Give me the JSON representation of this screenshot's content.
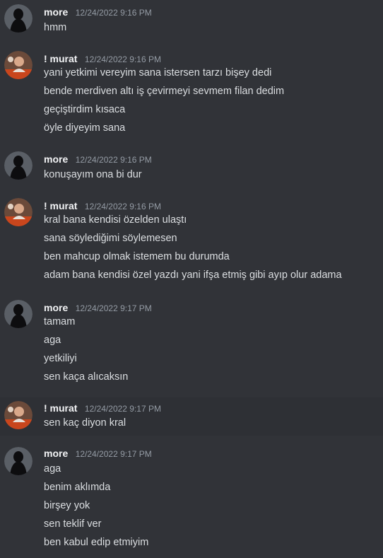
{
  "channel": {
    "messages": [
      {
        "author": "more",
        "timestamp": "12/24/2022 9:16 PM",
        "avatar": "dark-hooded-figure-avatar",
        "lines": [
          "hmm"
        ]
      },
      {
        "author": "! murat",
        "timestamp": "12/24/2022 9:16 PM",
        "avatar": "photo-avatar",
        "lines": [
          "yani yetkimi vereyim sana istersen tarzı bişey dedi",
          "bende merdiven altı iş çevirmeyi sevmem filan dedim",
          "geçiştirdim kısaca",
          "öyle diyeyim sana"
        ]
      },
      {
        "author": "more",
        "timestamp": "12/24/2022 9:16 PM",
        "avatar": "dark-hooded-figure-avatar",
        "lines": [
          "konuşayım ona bi dur"
        ]
      },
      {
        "author": "! murat",
        "timestamp": "12/24/2022 9:16 PM",
        "avatar": "photo-avatar",
        "lines": [
          "kral bana kendisi özelden ulaştı",
          "sana söylediğimi söylemesen",
          "ben mahcup olmak istemem bu durumda",
          "adam bana kendisi özel yazdı yani ifşa etmiş gibi ayıp olur adama"
        ]
      },
      {
        "author": "more",
        "timestamp": "12/24/2022 9:17 PM",
        "avatar": "dark-hooded-figure-avatar",
        "lines": [
          "tamam",
          "aga",
          "yetkiliyi",
          "sen kaça alıcaksın"
        ]
      },
      {
        "author": "! murat",
        "timestamp": "12/24/2022 9:17 PM",
        "avatar": "photo-avatar",
        "lines": [
          "sen kaç diyon kral"
        ]
      },
      {
        "author": "more",
        "timestamp": "12/24/2022 9:17 PM",
        "avatar": "dark-hooded-figure-avatar",
        "lines": [
          "aga",
          "benim aklımda",
          "birşey yok",
          "sen teklif ver",
          "ben kabul edip etmiyim"
        ]
      }
    ]
  }
}
